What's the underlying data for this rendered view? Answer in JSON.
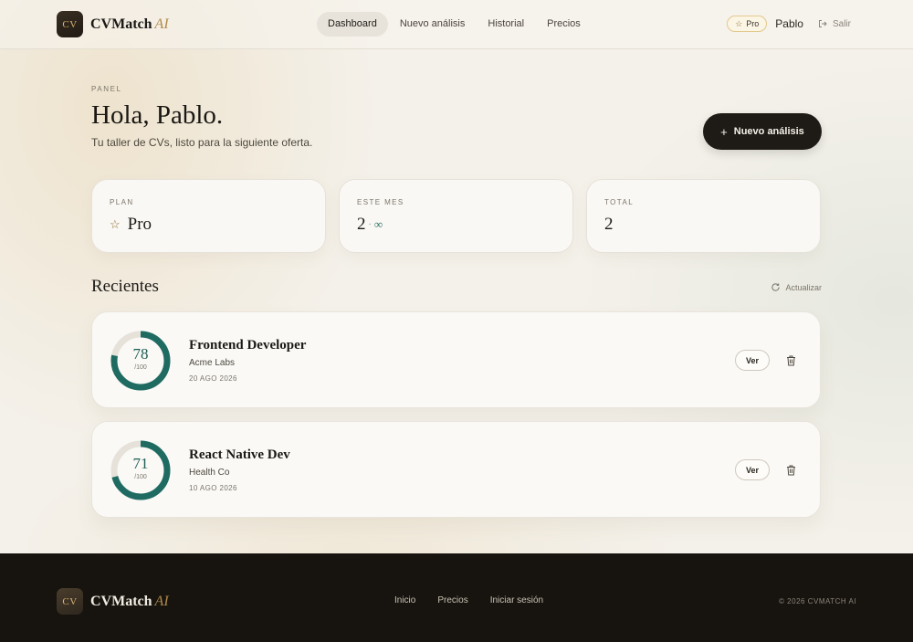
{
  "brand": {
    "mark": "CV",
    "name": "CVMatch",
    "suffix": "AI"
  },
  "nav": {
    "items": [
      {
        "label": "Dashboard",
        "active": true
      },
      {
        "label": "Nuevo análisis",
        "active": false
      },
      {
        "label": "Historial",
        "active": false
      },
      {
        "label": "Precios",
        "active": false
      }
    ]
  },
  "header": {
    "plan_badge": "Pro",
    "user": "Pablo",
    "logout": "Salir"
  },
  "hero": {
    "eyebrow": "PANEL",
    "greeting": "Hola, Pablo.",
    "subtitle": "Tu taller de CVs, listo para la siguiente oferta.",
    "cta": "Nuevo análisis"
  },
  "stats": [
    {
      "label": "PLAN",
      "value": "Pro",
      "icon": "star-icon"
    },
    {
      "label": "ESTE MES",
      "value": "2",
      "separator": "·",
      "limit": "∞"
    },
    {
      "label": "TOTAL",
      "value": "2"
    }
  ],
  "recents": {
    "title": "Recientes",
    "refresh": "Actualizar",
    "items": [
      {
        "score": 78,
        "max": "/100",
        "title": "Frontend Developer",
        "company": "Acme Labs",
        "date": "20 AGO 2026",
        "view": "Ver"
      },
      {
        "score": 71,
        "max": "/100",
        "title": "React Native Dev",
        "company": "Health Co",
        "date": "10 AGO 2026",
        "view": "Ver"
      }
    ]
  },
  "footer": {
    "links": [
      "Inicio",
      "Precios",
      "Iniciar sesión"
    ],
    "copyright": "© 2026 CVMATCH AI"
  },
  "colors": {
    "accent": "#1f6b62",
    "dark": "#1e1a15",
    "gold": "#b08a4a"
  }
}
